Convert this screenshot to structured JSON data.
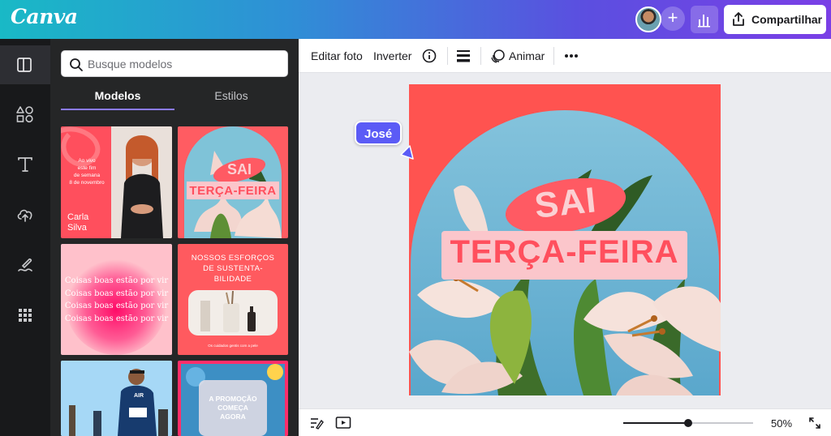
{
  "app": {
    "name": "Canva"
  },
  "header": {
    "share_label": "Compartilhar",
    "add_label": "+"
  },
  "rail": {
    "items": [
      "layout-icon",
      "elements-icon",
      "text-icon",
      "upload-icon",
      "draw-icon",
      "apps-icon"
    ]
  },
  "panel": {
    "search_placeholder": "Busque modelos",
    "tabs": [
      {
        "label": "Modelos",
        "active": true
      },
      {
        "label": "Estilos",
        "active": false
      }
    ],
    "templates": [
      {
        "lines": [
          "Ao vivo",
          "este fim",
          "de semana",
          "8 de novembro"
        ],
        "name": "Carla Silva"
      },
      {
        "top": "SAI",
        "bottom": "TERÇA-FEIRA"
      },
      {
        "line": "Coisas boas estão por vir"
      },
      {
        "title": "NOSSOS ESFORÇOS DE SUSTENTA-BILIDADE",
        "caption": "Os cuidados gentis com a pele"
      },
      {
        "badge": "AIR"
      },
      {
        "text": "A PROMOÇÃO COMEÇA AGORA"
      }
    ]
  },
  "toolbar": {
    "edit_photo": "Editar foto",
    "flip": "Inverter",
    "animate": "Animar"
  },
  "canvas": {
    "collaborator": "José",
    "design": {
      "top_text": "SAI",
      "bottom_text": "TERÇA-FEIRA"
    }
  },
  "bottom": {
    "zoom": "50%",
    "zoom_fraction": 0.5
  },
  "colors": {
    "brand_gradient_start": "#19b9c6",
    "brand_gradient_end": "#7a3fe6",
    "accent": "#8b7bff",
    "design_bg": "#ff5350",
    "cursor": "#5b5bf6"
  }
}
